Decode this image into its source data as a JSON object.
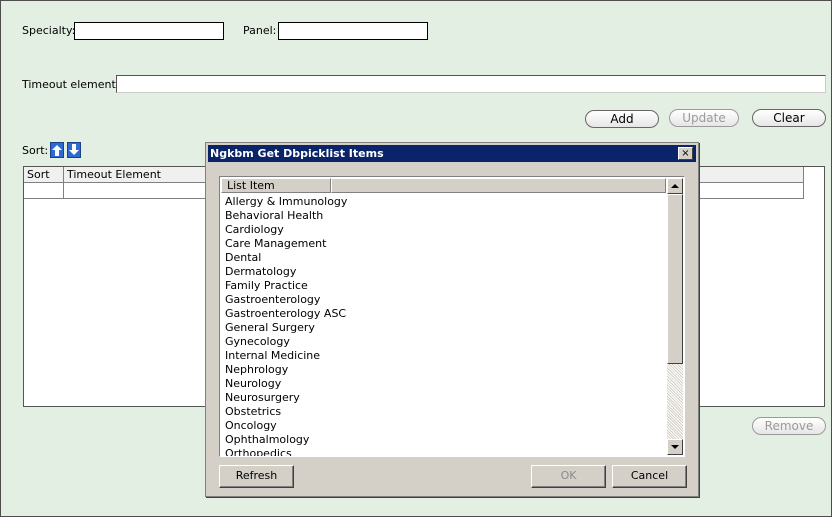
{
  "form": {
    "specialty_label": "Specialty:",
    "specialty_value": "",
    "panel_label": "Panel:",
    "panel_value": "",
    "timeout_label": "Timeout element:",
    "timeout_value": ""
  },
  "buttons": {
    "add": "Add",
    "update": "Update",
    "clear": "Clear",
    "remove": "Remove"
  },
  "sort": {
    "label": "Sort:"
  },
  "grid": {
    "columns": [
      "Sort",
      "Timeout Element"
    ]
  },
  "dialog": {
    "title": "Ngkbm Get Dbpicklist Items",
    "close": "×",
    "column": "List Item",
    "items": [
      "Allergy & Immunology",
      "Behavioral Health",
      "Cardiology",
      "Care Management",
      "Dental",
      "Dermatology",
      "Family Practice",
      "Gastroenterology",
      "Gastroenterology ASC",
      "General Surgery",
      "Gynecology",
      "Internal Medicine",
      "Nephrology",
      "Neurology",
      "Neurosurgery",
      "Obstetrics",
      "Oncology",
      "Ophthalmology",
      "Orthopedics"
    ],
    "refresh": "Refresh",
    "ok": "OK",
    "cancel": "Cancel"
  },
  "icons": {
    "sort_up": "arrow-up-icon",
    "sort_down": "arrow-down-icon"
  },
  "colors": {
    "background": "#e4efe3",
    "titlebar": "#0a246a",
    "sort_button": "#2d6ad6"
  }
}
